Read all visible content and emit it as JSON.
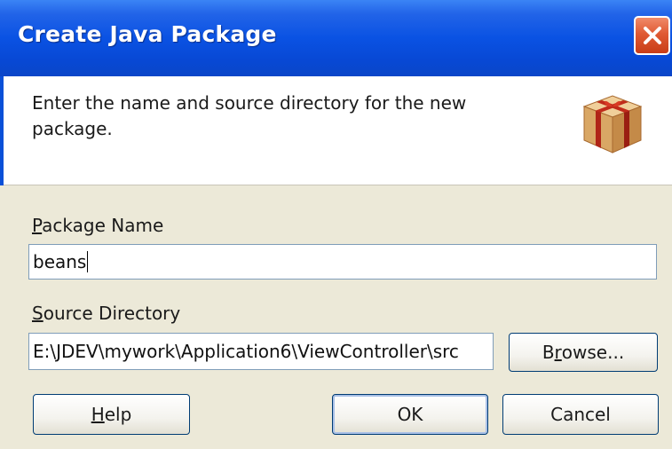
{
  "window": {
    "title": "Create Java Package",
    "close_icon": "close-icon"
  },
  "header": {
    "description": "Enter the name and source directory for the new package.",
    "icon": "package-icon"
  },
  "form": {
    "package_name": {
      "label_mnemonic": "P",
      "label_rest": "ackage Name",
      "value": "beans"
    },
    "source_directory": {
      "label_mnemonic": "S",
      "label_rest": "ource Directory",
      "value": "E:\\JDEV\\mywork\\Application6\\ViewController\\src"
    },
    "browse_button": {
      "pre": "B",
      "mnemonic": "r",
      "post": "owse..."
    }
  },
  "buttons": {
    "help": {
      "mnemonic": "H",
      "rest": "elp"
    },
    "ok": "OK",
    "cancel": "Cancel"
  },
  "colors": {
    "titlebar": "#0a52e3",
    "dialog_bg": "#ece9d8",
    "close_button": "#e05a33",
    "package_box": "#d8a86a",
    "package_ribbon": "#c02a1a"
  }
}
